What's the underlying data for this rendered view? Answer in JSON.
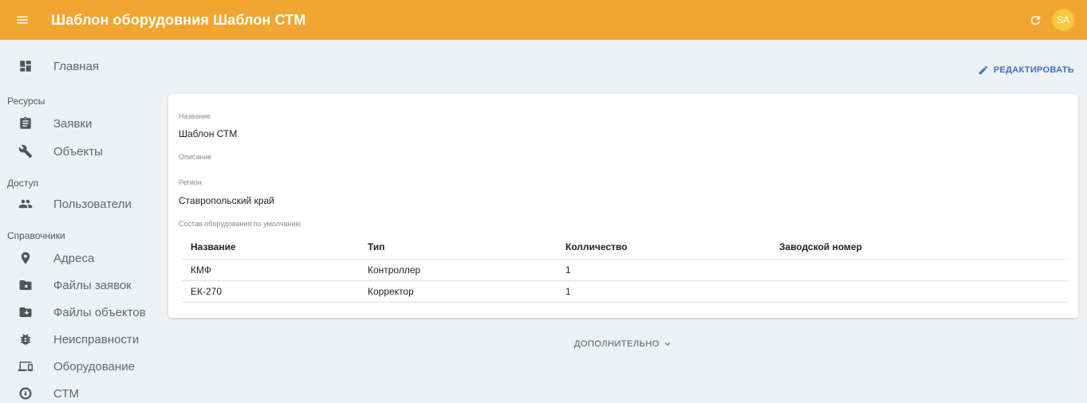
{
  "appbar": {
    "title": "Шаблон оборудовния Шаблон СТМ",
    "menu_icon": "menu-icon",
    "refresh_icon": "refresh-icon",
    "avatar_initials": "SA",
    "color": "#f0a630"
  },
  "sidebar": {
    "home": {
      "label": "Главная",
      "icon": "dashboard-icon"
    },
    "section_resources": "Ресурсы",
    "requests": {
      "label": "Заявки",
      "icon": "clipboard-icon"
    },
    "objects": {
      "label": "Объекты",
      "icon": "wrench-icon"
    },
    "section_access": "Доступ",
    "users": {
      "label": "Пользователи",
      "icon": "people-icon"
    },
    "section_refs": "Справочники",
    "addresses": {
      "label": "Адреса",
      "icon": "place-icon"
    },
    "request_files": {
      "label": "Файлы заявок",
      "icon": "folder-icon"
    },
    "object_files": {
      "label": "Файлы объектов",
      "icon": "folder-shared-icon"
    },
    "faults": {
      "label": "Неисправности",
      "icon": "bug-icon"
    },
    "equipment": {
      "label": "Оборудование",
      "icon": "devices-icon"
    },
    "stm": {
      "label": "СТМ",
      "icon": "gauge-icon"
    }
  },
  "toolbar": {
    "edit_label": "РЕДАКТИРОВАТЬ",
    "edit_icon": "pencil-icon",
    "accent": "#3f6fc5"
  },
  "details": {
    "name_label": "Название",
    "name_value": "Шаблон СТМ",
    "description_label": "Описание",
    "region_label": "Регион",
    "region_value": "Ставропольский край",
    "composition_label": "Состав оборудования по умолчанию"
  },
  "table": {
    "headers": [
      "Название",
      "Тип",
      "Колличество",
      "Заводской номер"
    ],
    "rows": [
      [
        "КМФ",
        "Контроллер",
        "1",
        ""
      ],
      [
        "ЕК-270",
        "Корректор",
        "1",
        ""
      ]
    ]
  },
  "more": {
    "label": "ДОПОЛНИТЕЛЬНО",
    "icon": "chevron-down-icon"
  }
}
